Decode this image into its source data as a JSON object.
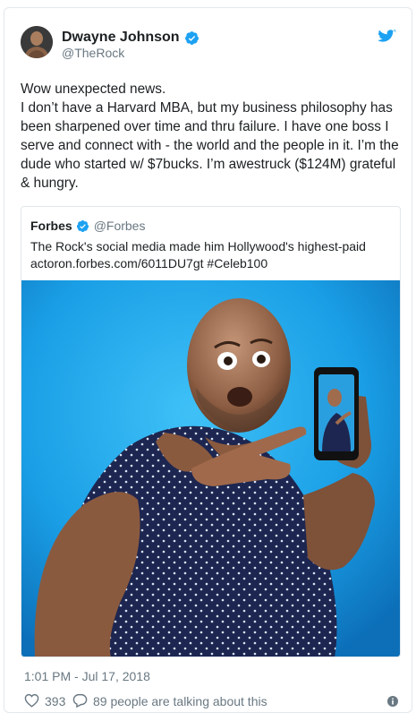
{
  "colors": {
    "accent": "#1da1f2",
    "text": "#1c2022",
    "muted": "#697882",
    "border": "#e1e8ed",
    "photo_background": "#1ca2e8"
  },
  "tweet": {
    "author_name": "Dwayne Johnson",
    "author_handle": "@TheRock",
    "verified_icon": "verified-badge-icon",
    "platform_icon": "twitter-bird-icon",
    "text": "Wow unexpected news.\nI don’t have a Harvard MBA, but my business philosophy has been sharpened over time and thru failure. I have one boss I serve and connect with - the world and the people in it. I’m the dude who started w/ $7bucks. I’m awestruck ($124M) grateful & hungry.",
    "timestamp": "1:01 PM - Jul 17, 2018",
    "likes": "393",
    "talking": "89 people are talking about this"
  },
  "quoted": {
    "author_name": "Forbes",
    "author_handle": "@Forbes",
    "text": "The Rock's social media made him Hollywood's highest-paid actoron.forbes.com/6011DU7gt  #Celeb100"
  }
}
